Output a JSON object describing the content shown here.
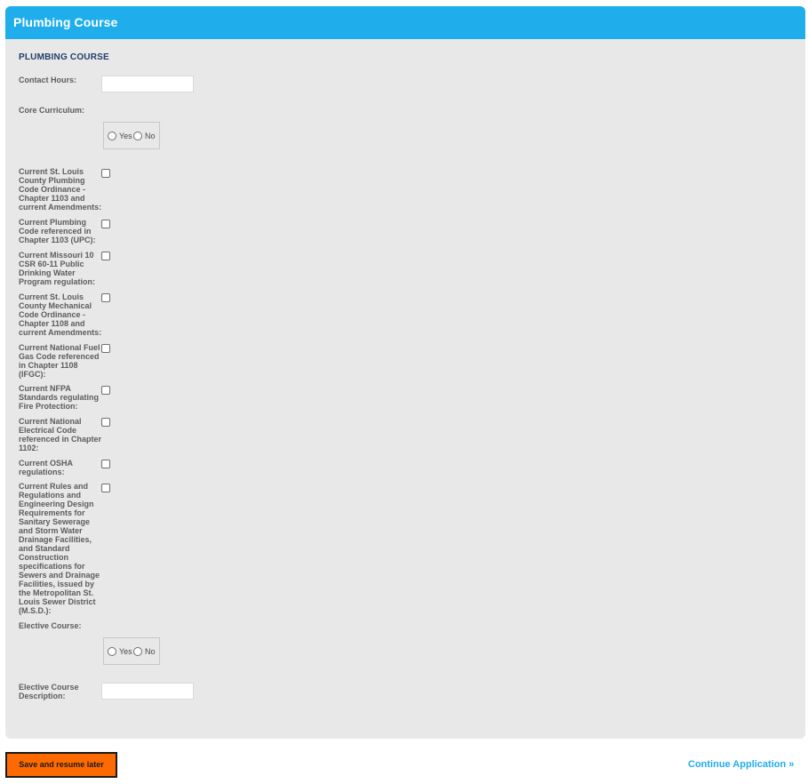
{
  "panel": {
    "header_title": "Plumbing Course",
    "section_title": "PLUMBING COURSE"
  },
  "form": {
    "contact_hours": {
      "label": "Contact Hours:",
      "value": ""
    },
    "core_curriculum": {
      "label": "Core Curriculum:",
      "yes_label": "Yes",
      "no_label": "No"
    },
    "checkboxes": [
      {
        "label": "Current St. Louis County Plumbing Code Ordinance - Chapter 1103 and current Amendments:",
        "checked": false
      },
      {
        "label": "Current Plumbing Code referenced in Chapter 1103 (UPC):",
        "checked": false
      },
      {
        "label": "Current Missouri 10 CSR 60-11 Public Drinking Water Program regulation:",
        "checked": false
      },
      {
        "label": "Current St. Louis County Mechanical Code Ordinance - Chapter 1108 and current Amendments:",
        "checked": false
      },
      {
        "label": "Current National Fuel Gas Code referenced in Chapter 1108 (IFGC):",
        "checked": false
      },
      {
        "label": "Current NFPA Standards regulating Fire Protection:",
        "checked": false
      },
      {
        "label": "Current National Electrical Code referenced in Chapter 1102:",
        "checked": false
      },
      {
        "label": "Current OSHA regulations:",
        "checked": false
      },
      {
        "label": "Current Rules and Regulations and Engineering Design Requirements for Sanitary Sewerage and Storm Water Drainage Facilities, and Standard Construction specifications for Sewers and Drainage Facilities, issued by the Metropolitan St. Louis Sewer District (M.S.D.):",
        "checked": false
      }
    ],
    "elective_course": {
      "label": "Elective Course:",
      "yes_label": "Yes",
      "no_label": "No"
    },
    "elective_description": {
      "label": "Elective Course Description:",
      "value": ""
    }
  },
  "footer": {
    "save_label": "Save and resume later",
    "continue_label": "Continue Application »"
  },
  "colors": {
    "header_blue": "#1fadec",
    "panel_gray": "#e8e8e8",
    "save_orange": "#ff6a00",
    "section_navy": "#1f3d6b"
  }
}
